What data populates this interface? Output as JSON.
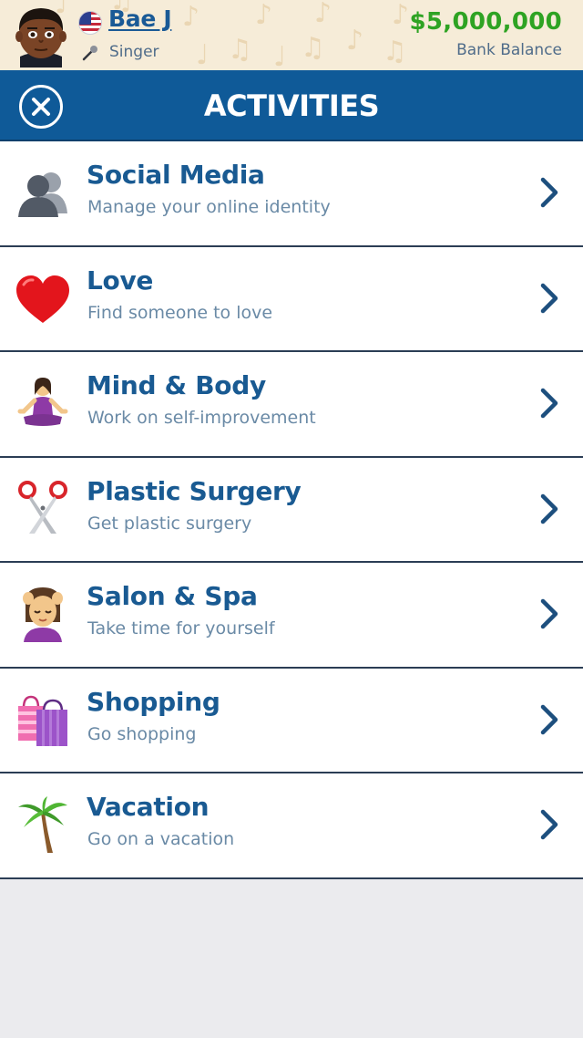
{
  "player": {
    "name": "Bae J",
    "occupation": "Singer",
    "country_flag_icon": "us-flag-icon",
    "balance": "$5,000,000",
    "balance_label": "Bank Balance"
  },
  "header": {
    "title": "ACTIVITIES",
    "close_icon": "close-icon"
  },
  "activities": [
    {
      "title": "Social Media",
      "subtitle": "Manage your online identity",
      "icon": "silhouettes-icon"
    },
    {
      "title": "Love",
      "subtitle": "Find someone to love",
      "icon": "heart-icon"
    },
    {
      "title": "Mind & Body",
      "subtitle": "Work on self-improvement",
      "icon": "meditation-icon"
    },
    {
      "title": "Plastic Surgery",
      "subtitle": "Get plastic surgery",
      "icon": "scissors-icon"
    },
    {
      "title": "Salon & Spa",
      "subtitle": "Take time for yourself",
      "icon": "head-massage-icon"
    },
    {
      "title": "Shopping",
      "subtitle": "Go shopping",
      "icon": "shopping-bags-icon"
    },
    {
      "title": "Vacation",
      "subtitle": "Go on a vacation",
      "icon": "palm-tree-icon"
    }
  ],
  "colors": {
    "header_bg": "#0f5a98",
    "title_text": "#195a92",
    "subtitle_text": "#6a8aa6",
    "balance_text": "#2ea323",
    "topbar_bg": "#f6ecd8",
    "page_bg": "#ebebee"
  }
}
